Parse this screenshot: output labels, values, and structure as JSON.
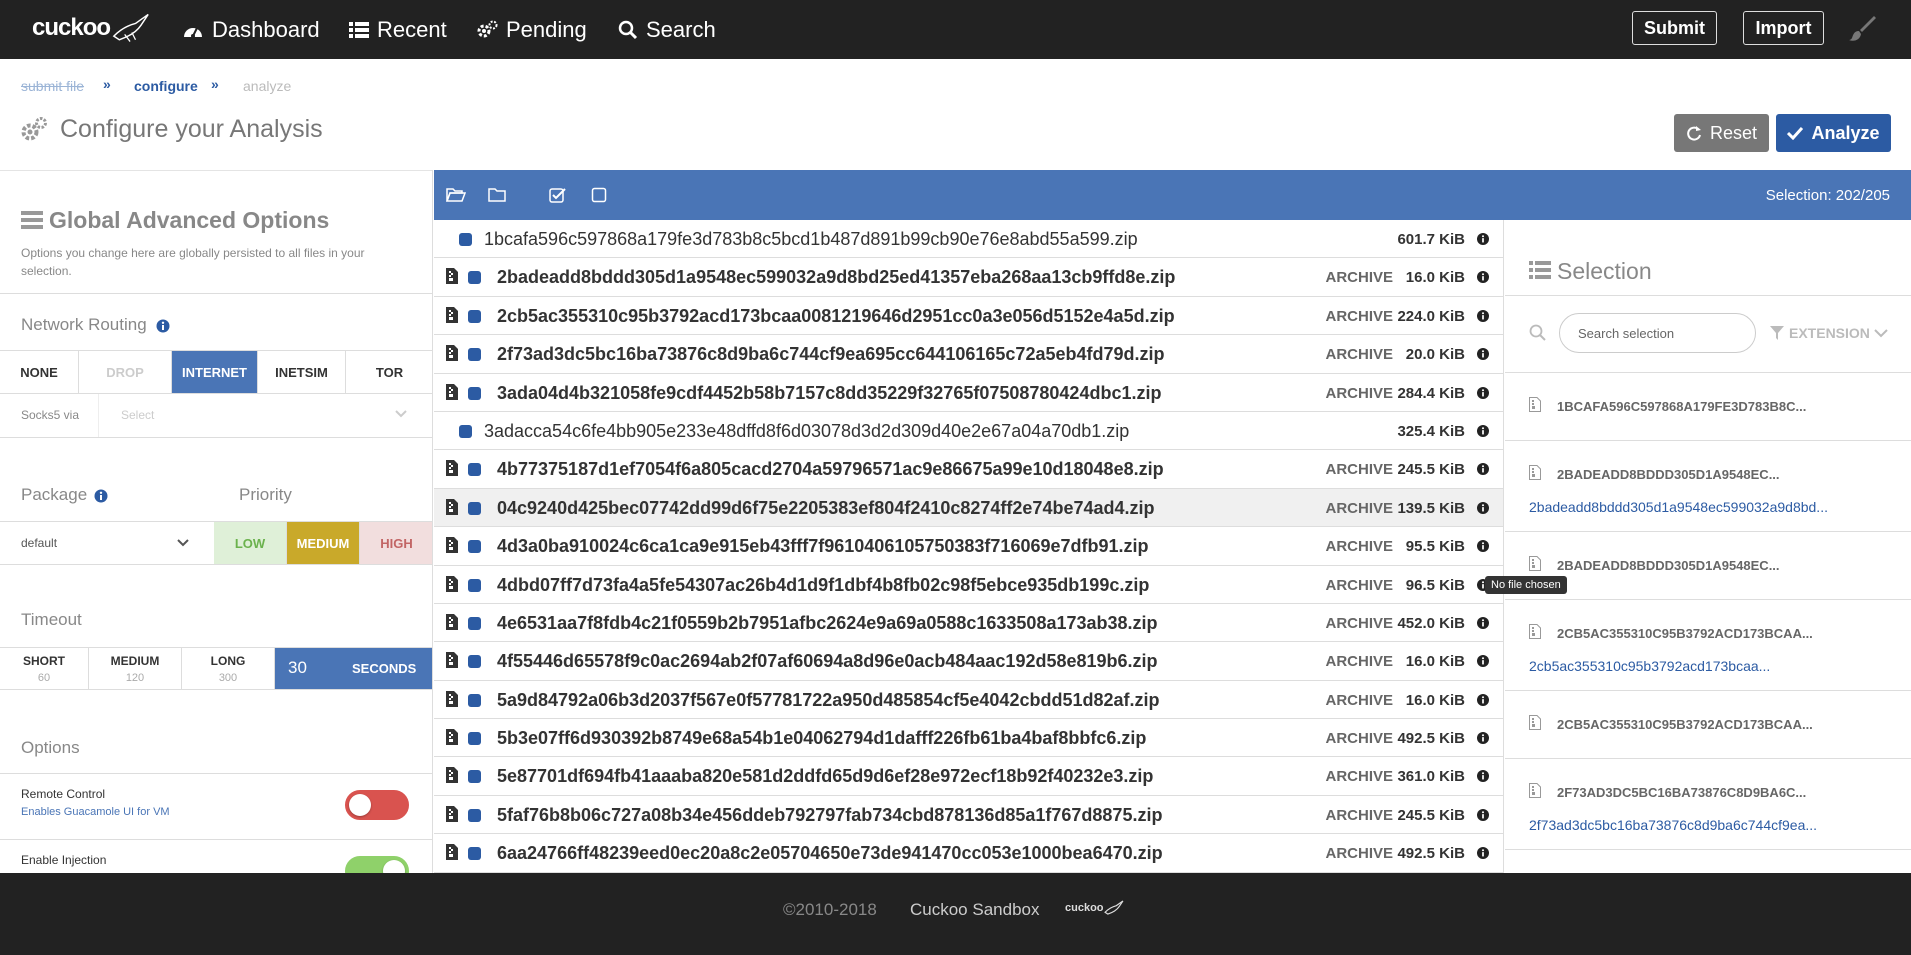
{
  "navbar": {
    "brand": "cuckoo",
    "items": [
      {
        "label": "Dashboard",
        "icon": "dashboard-icon"
      },
      {
        "label": "Recent",
        "icon": "list-icon"
      },
      {
        "label": "Pending",
        "icon": "cogs-icon"
      },
      {
        "label": "Search",
        "icon": "search-icon"
      }
    ],
    "submit_label": "Submit",
    "import_label": "Import"
  },
  "breadcrumb": {
    "step1": "submit file",
    "step2": "configure",
    "step3": "analyze"
  },
  "page": {
    "title": "Configure your Analysis",
    "reset_label": "Reset",
    "analyze_label": "Analyze"
  },
  "global_options": {
    "title": "Global Advanced Options",
    "description": "Options you change here are globally persisted to all files in your selection.",
    "network_routing_label": "Network Routing",
    "routing_options": [
      "NONE",
      "DROP",
      "INTERNET",
      "INETSIM",
      "TOR"
    ],
    "routing_selected": "INTERNET",
    "socks5_label": "Socks5 via",
    "socks5_placeholder": "Select",
    "package_label": "Package",
    "package_value": "default",
    "priority_label": "Priority",
    "priority_options": [
      "LOW",
      "MEDIUM",
      "HIGH"
    ],
    "priority_selected": "MEDIUM",
    "timeout_label": "Timeout",
    "timeout_options": [
      {
        "label": "SHORT",
        "value": "60"
      },
      {
        "label": "MEDIUM",
        "value": "120"
      },
      {
        "label": "LONG",
        "value": "300"
      }
    ],
    "timeout_custom_value": "30",
    "timeout_custom_unit": "SECONDS",
    "options_label": "Options",
    "remote_control_label": "Remote Control",
    "remote_control_desc": "Enables Guacamole UI for VM",
    "enable_injection_label": "Enable Injection"
  },
  "toolbar": {
    "selection_status": "Selection: 202/205"
  },
  "files": [
    {
      "name": "1bcafa596c597868a179fe3d783b8c5bcd1b487d891b99cb90e76e8abd55a599.zip",
      "type": "",
      "size": "601.7 KiB",
      "indent": false,
      "bold": false
    },
    {
      "name": "2badeadd8bddd305d1a9548ec599032a9d8bd25ed41357eba268aa13cb9ffd8e.zip",
      "type": "ARCHIVE",
      "size": "16.0 KiB",
      "indent": true,
      "bold": true
    },
    {
      "name": "2cb5ac355310c95b3792acd173bcaa0081219646d2951cc0a3e056d5152e4a5d.zip",
      "type": "ARCHIVE",
      "size": "224.0 KiB",
      "indent": true,
      "bold": true
    },
    {
      "name": "2f73ad3dc5bc16ba73876c8d9ba6c744cf9ea695cc644106165c72a5eb4fd79d.zip",
      "type": "ARCHIVE",
      "size": "20.0 KiB",
      "indent": true,
      "bold": true
    },
    {
      "name": "3ada04d4b321058fe9cdf4452b58b7157c8dd35229f32765f07508780424dbc1.zip",
      "type": "ARCHIVE",
      "size": "284.4 KiB",
      "indent": true,
      "bold": true
    },
    {
      "name": "3adacca54c6fe4bb905e233e48dffd8f6d03078d3d2d309d40e2e67a04a70db1.zip",
      "type": "",
      "size": "325.4 KiB",
      "indent": false,
      "bold": false
    },
    {
      "name": "4b77375187d1ef7054f6a805cacd2704a59796571ac9e86675a99e10d18048e8.zip",
      "type": "ARCHIVE",
      "size": "245.5 KiB",
      "indent": true,
      "bold": true
    },
    {
      "name": "04c9240d425bec07742dd99d6f75e2205383ef804f2410c8274ff2e74be74ad4.zip",
      "type": "ARCHIVE",
      "size": "139.5 KiB",
      "indent": true,
      "bold": true
    },
    {
      "name": "4d3a0ba910024c6ca1ca9e915eb43fff7f9610406105750383f716069e7dfb91.zip",
      "type": "ARCHIVE",
      "size": "95.5 KiB",
      "indent": true,
      "bold": true
    },
    {
      "name": "4dbd07ff7d73fa4a5fe54307ac26b4d1d9f1dbf4b8fb02c98f5ebce935db199c.zip",
      "type": "ARCHIVE",
      "size": "96.5 KiB",
      "indent": true,
      "bold": true
    },
    {
      "name": "4e6531aa7f8fdb4c21f0559b2b7951afbc2624e9a69a0588c1633508a173ab38.zip",
      "type": "ARCHIVE",
      "size": "452.0 KiB",
      "indent": true,
      "bold": true
    },
    {
      "name": "4f55446d65578f9c0ac2694ab2f07af60694a8d96e0acb484aac192d58e819b6.zip",
      "type": "ARCHIVE",
      "size": "16.0 KiB",
      "indent": true,
      "bold": true
    },
    {
      "name": "5a9d84792a06b3d2037f567e0f57781722a950d485854cf5e4042cbdd51d82af.zip",
      "type": "ARCHIVE",
      "size": "16.0 KiB",
      "indent": true,
      "bold": true
    },
    {
      "name": "5b3e07ff6d930392b8749e68a54b1e04062794d1dafff226fb61ba4baf8bbfc6.zip",
      "type": "ARCHIVE",
      "size": "492.5 KiB",
      "indent": true,
      "bold": true
    },
    {
      "name": "5e87701df694fb41aaaba820e581d2ddfd65d9d6ef28e972ecf18b92f40232e3.zip",
      "type": "ARCHIVE",
      "size": "361.0 KiB",
      "indent": true,
      "bold": true
    },
    {
      "name": "5faf76b8b06c727a08b34e456ddeb792797fab734cbd878136d85a1f767d8875.zip",
      "type": "ARCHIVE",
      "size": "245.5 KiB",
      "indent": true,
      "bold": true
    },
    {
      "name": "6aa24766ff48239eed0ec20a8c2e05704650e73de941470cc053e1000bea6470.zip",
      "type": "ARCHIVE",
      "size": "492.5 KiB",
      "indent": true,
      "bold": true
    }
  ],
  "selection": {
    "title": "Selection",
    "search_placeholder": "Search selection",
    "extension_label": "EXTENSION",
    "items": [
      {
        "name": "1BCAFA596C597868A179FE3D783B8C...",
        "link": ""
      },
      {
        "name": "2BADEADD8BDDD305D1A9548EC...",
        "link": "2badeadd8bddd305d1a9548ec599032a9d8bd..."
      },
      {
        "name": "2BADEADD8BDDD305D1A9548EC...",
        "link": ""
      },
      {
        "name": "2CB5AC355310C95B3792ACD173BCAA...",
        "link": "2cb5ac355310c95b3792acd173bcaa..."
      },
      {
        "name": "2CB5AC355310C95B3792ACD173BCAA...",
        "link": ""
      },
      {
        "name": "2F73AD3DC5BC16BA73876C8D9BA6C...",
        "link": "2f73ad3dc5bc16ba73876c8d9ba6c744cf9ea..."
      }
    ]
  },
  "tooltip": "No file chosen",
  "footer": {
    "copyright": "©2010-2018",
    "name": "Cuckoo Sandbox",
    "brand": "cuckoo"
  },
  "colors": {
    "navbar": "#222222",
    "primary": "#2c5ba3",
    "toolbar": "#4a75b6",
    "priority_low": "#dff0d8",
    "priority_medium": "#c9a92a",
    "priority_high": "#f2dede",
    "toggle_off": "#d9534f",
    "toggle_on": "#8fd16a"
  }
}
